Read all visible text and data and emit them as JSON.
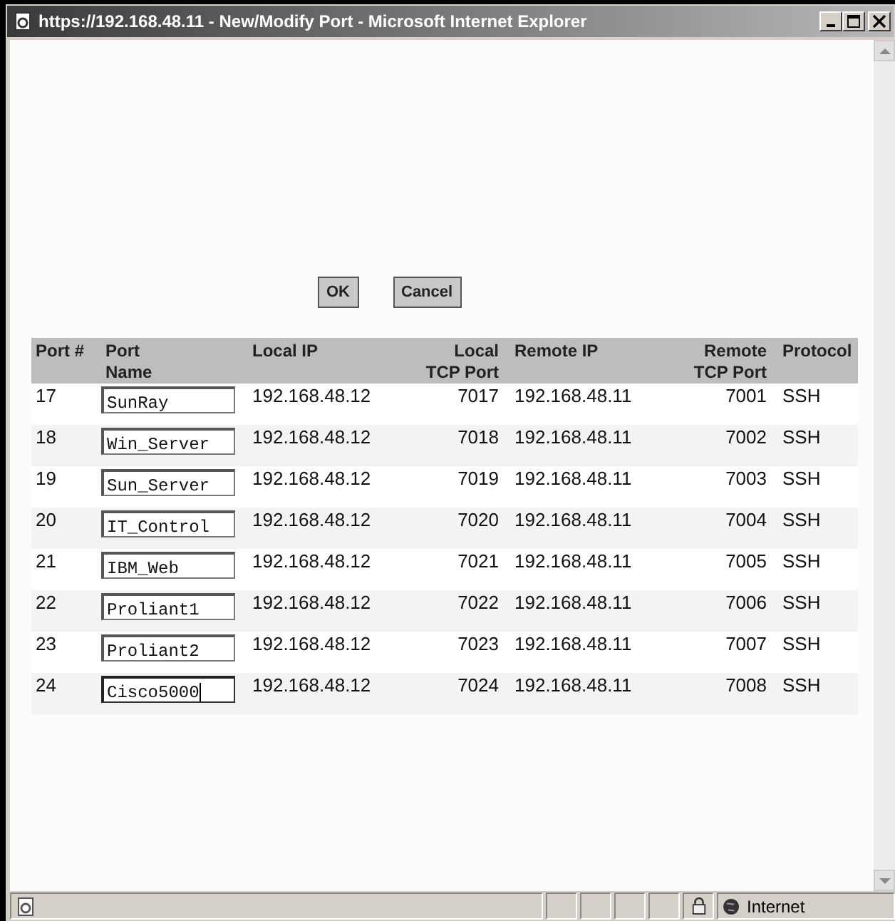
{
  "window": {
    "title": "https://192.168.48.11 - New/Modify Port - Microsoft Internet Explorer"
  },
  "buttons": [
    {
      "label": "OK"
    },
    {
      "label": "Cancel"
    }
  ],
  "table": {
    "columns": [
      "Port #",
      "Port\nName",
      "Local IP",
      "Local\nTCP Port",
      "Remote IP",
      "Remote\nTCP Port",
      "Protocol"
    ],
    "rows": [
      {
        "port": "17",
        "name": "SunRay",
        "local_ip": "192.168.48.12",
        "local_port": "7017",
        "remote_ip": "192.168.48.11",
        "remote_port": "7001",
        "protocol": "SSH",
        "focused": false
      },
      {
        "port": "18",
        "name": "Win_Server",
        "local_ip": "192.168.48.12",
        "local_port": "7018",
        "remote_ip": "192.168.48.11",
        "remote_port": "7002",
        "protocol": "SSH",
        "focused": false
      },
      {
        "port": "19",
        "name": "Sun_Server",
        "local_ip": "192.168.48.12",
        "local_port": "7019",
        "remote_ip": "192.168.48.11",
        "remote_port": "7003",
        "protocol": "SSH",
        "focused": false
      },
      {
        "port": "20",
        "name": "IT_Control",
        "local_ip": "192.168.48.12",
        "local_port": "7020",
        "remote_ip": "192.168.48.11",
        "remote_port": "7004",
        "protocol": "SSH",
        "focused": false
      },
      {
        "port": "21",
        "name": "IBM_Web",
        "local_ip": "192.168.48.12",
        "local_port": "7021",
        "remote_ip": "192.168.48.11",
        "remote_port": "7005",
        "protocol": "SSH",
        "focused": false
      },
      {
        "port": "22",
        "name": "Proliant1",
        "local_ip": "192.168.48.12",
        "local_port": "7022",
        "remote_ip": "192.168.48.11",
        "remote_port": "7006",
        "protocol": "SSH",
        "focused": false
      },
      {
        "port": "23",
        "name": "Proliant2",
        "local_ip": "192.168.48.12",
        "local_port": "7023",
        "remote_ip": "192.168.48.11",
        "remote_port": "7007",
        "protocol": "SSH",
        "focused": false
      },
      {
        "port": "24",
        "name": "Cisco5000",
        "local_ip": "192.168.48.12",
        "local_port": "7024",
        "remote_ip": "192.168.48.11",
        "remote_port": "7008",
        "protocol": "SSH",
        "focused": true
      }
    ]
  },
  "status_bar": {
    "zone": "Internet"
  }
}
